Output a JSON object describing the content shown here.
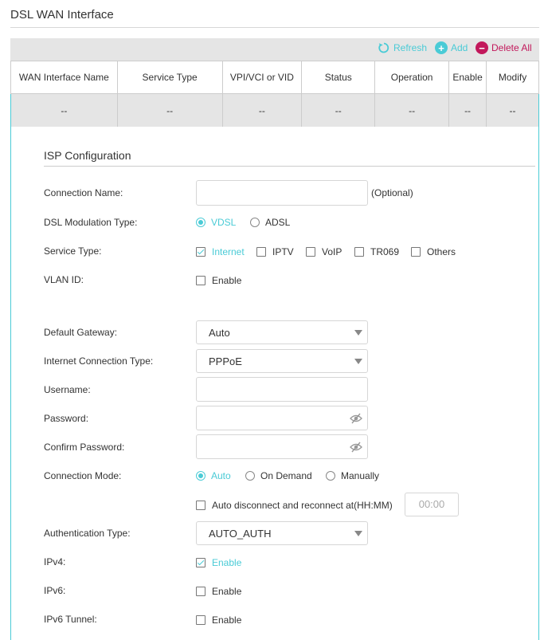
{
  "page_title": "DSL WAN Interface",
  "toolbar": {
    "refresh_label": "Refresh",
    "add_label": "Add",
    "delete_all_label": "Delete All"
  },
  "table": {
    "columns": [
      "WAN Interface Name",
      "Service Type",
      "VPI/VCI or VID",
      "Status",
      "Operation",
      "Enable",
      "Modify"
    ],
    "rows": [
      [
        "--",
        "--",
        "--",
        "--",
        "--",
        "--",
        "--"
      ]
    ]
  },
  "isp": {
    "section_title": "ISP Configuration",
    "connection_name": {
      "label": "Connection Name:",
      "value": "",
      "note": "(Optional)"
    },
    "modulation": {
      "label": "DSL Modulation Type:",
      "options": [
        "VDSL",
        "ADSL"
      ],
      "selected": "VDSL"
    },
    "service_type": {
      "label": "Service Type:",
      "options": [
        "Internet",
        "IPTV",
        "VoIP",
        "TR069",
        "Others"
      ],
      "checked": [
        "Internet"
      ]
    },
    "vlan_id": {
      "label": "VLAN ID:",
      "enable_label": "Enable",
      "checked": false
    },
    "default_gateway": {
      "label": "Default Gateway:",
      "value": "Auto"
    },
    "connection_type": {
      "label": "Internet Connection Type:",
      "value": "PPPoE"
    },
    "username": {
      "label": "Username:",
      "value": ""
    },
    "password": {
      "label": "Password:",
      "value": ""
    },
    "confirm_password": {
      "label": "Confirm Password:",
      "value": ""
    },
    "connection_mode": {
      "label": "Connection Mode:",
      "options": [
        "Auto",
        "On Demand",
        "Manually"
      ],
      "selected": "Auto",
      "auto_reconnect_label": "Auto disconnect and reconnect at(HH:MM)",
      "auto_reconnect_checked": false,
      "time_value": "00:00"
    },
    "auth_type": {
      "label": "Authentication Type:",
      "value": "AUTO_AUTH"
    },
    "ipv4": {
      "label": "IPv4:",
      "enable_label": "Enable",
      "checked": true
    },
    "ipv6": {
      "label": "IPv6:",
      "enable_label": "Enable",
      "checked": false
    },
    "ipv6_tunnel": {
      "label": "IPv6 Tunnel:",
      "enable_label": "Enable",
      "checked": false
    }
  },
  "colors": {
    "accent": "#4acbd6",
    "danger": "#c2185b",
    "table_bg": "#e5e5e5"
  },
  "icons": {
    "refresh": "refresh-icon",
    "add": "plus-circle-icon",
    "delete": "minus-circle-icon",
    "eye": "eye-off-icon"
  }
}
